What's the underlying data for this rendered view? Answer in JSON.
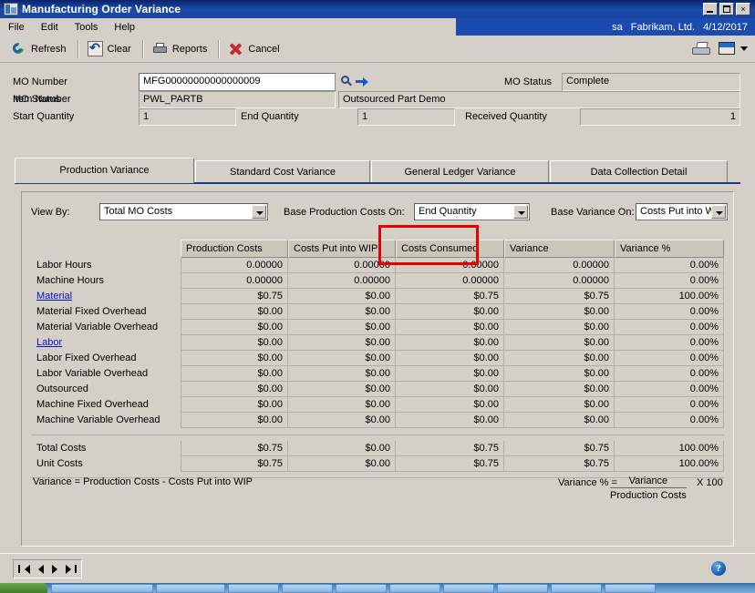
{
  "window": {
    "title": "Manufacturing Order Variance",
    "icon": "window-icon",
    "minimize": "_",
    "maximize": "",
    "close": "×"
  },
  "menu": {
    "items": [
      {
        "label": "File"
      },
      {
        "label": "Edit"
      },
      {
        "label": "Tools"
      },
      {
        "label": "Help"
      }
    ]
  },
  "userbar": {
    "user": "sa",
    "company": "Fabrikam, Ltd.",
    "date": "4/12/2017"
  },
  "toolbar": {
    "refresh": "Refresh",
    "clear": "Clear",
    "reports": "Reports",
    "cancel": "Cancel"
  },
  "header": {
    "mo_number_label": "MO Number",
    "mo_number_value": "MFG00000000000000009",
    "item_number_label": "Item Number",
    "item_number_value": "PWL_PARTB",
    "item_description": "Outsourced Part Demo",
    "mo_status_label": "MO Status",
    "mo_status_value": "Complete",
    "start_quantity_label": "Start Quantity",
    "start_quantity_value": "1",
    "end_quantity_label": "End Quantity",
    "end_quantity_value": "1",
    "received_quantity_label": "Received Quantity",
    "received_quantity_value": "1"
  },
  "tabs": [
    {
      "label": "Production Variance",
      "active": true
    },
    {
      "label": "Standard Cost Variance",
      "active": false
    },
    {
      "label": "General Ledger Variance",
      "active": false
    },
    {
      "label": "Data Collection Detail",
      "active": false
    }
  ],
  "controls": {
    "view_by_label": "View By:",
    "view_by_value": "Total MO Costs",
    "base_production_label": "Base Production Costs On:",
    "base_production_value": "End Quantity",
    "base_variance_label": "Base Variance On:",
    "base_variance_value": "Costs Put into WIP"
  },
  "grid": {
    "columns": [
      "Production Costs",
      "Costs Put into WIP",
      "Costs Consumed",
      "Variance",
      "Variance %"
    ],
    "rows": [
      {
        "label": "Labor Hours",
        "link": false,
        "values": [
          "0.00000",
          "0.00000",
          "0.00000",
          "0.00000",
          "0.00%"
        ]
      },
      {
        "label": "Machine Hours",
        "link": false,
        "values": [
          "0.00000",
          "0.00000",
          "0.00000",
          "0.00000",
          "0.00%"
        ]
      },
      {
        "label": "Material",
        "link": true,
        "values": [
          "$0.75",
          "$0.00",
          "$0.75",
          "$0.75",
          "100.00%"
        ]
      },
      {
        "label": "Material Fixed Overhead",
        "link": false,
        "values": [
          "$0.00",
          "$0.00",
          "$0.00",
          "$0.00",
          "0.00%"
        ]
      },
      {
        "label": "Material Variable Overhead",
        "link": false,
        "values": [
          "$0.00",
          "$0.00",
          "$0.00",
          "$0.00",
          "0.00%"
        ]
      },
      {
        "label": "Labor",
        "link": true,
        "values": [
          "$0.00",
          "$0.00",
          "$0.00",
          "$0.00",
          "0.00%"
        ]
      },
      {
        "label": "Labor Fixed Overhead",
        "link": false,
        "values": [
          "$0.00",
          "$0.00",
          "$0.00",
          "$0.00",
          "0.00%"
        ]
      },
      {
        "label": "Labor Variable Overhead",
        "link": false,
        "values": [
          "$0.00",
          "$0.00",
          "$0.00",
          "$0.00",
          "0.00%"
        ]
      },
      {
        "label": "Outsourced",
        "link": false,
        "values": [
          "$0.00",
          "$0.00",
          "$0.00",
          "$0.00",
          "0.00%"
        ]
      },
      {
        "label": "Machine Fixed Overhead",
        "link": false,
        "values": [
          "$0.00",
          "$0.00",
          "$0.00",
          "$0.00",
          "0.00%"
        ]
      },
      {
        "label": "Machine Variable Overhead",
        "link": false,
        "values": [
          "$0.00",
          "$0.00",
          "$0.00",
          "$0.00",
          "0.00%"
        ]
      }
    ],
    "totals": [
      {
        "label": "Total Costs",
        "values": [
          "$0.75",
          "$0.00",
          "$0.75",
          "$0.75",
          "100.00%"
        ]
      },
      {
        "label": "Unit Costs",
        "values": [
          "$0.75",
          "$0.00",
          "$0.75",
          "$0.75",
          "100.00%"
        ]
      }
    ]
  },
  "formula": {
    "variance_definition": "Variance = Production Costs - Costs Put into WIP",
    "variance_pct_label": "Variance % =",
    "numerator": "Variance",
    "denominator": "Production Costs",
    "multiplier": "X 100"
  },
  "status": {
    "first": "first-record",
    "previous": "previous-record",
    "next": "next-record",
    "last": "last-record",
    "help": "?"
  },
  "annotation": {
    "highlight_color": "#e80000",
    "target_column": "Costs Consumed"
  }
}
